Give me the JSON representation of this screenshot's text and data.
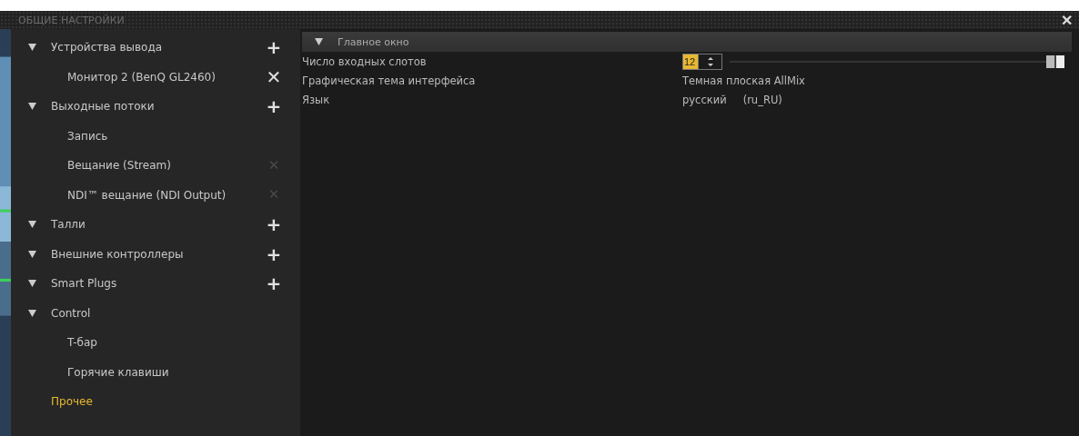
{
  "window": {
    "title": "ОБЩИЕ НАСТРОЙКИ",
    "close": "✕"
  },
  "sidebar": {
    "items": [
      {
        "label": "Устройства вывода",
        "expanded": true,
        "selected": false,
        "button": "+",
        "children": [
          {
            "label": "Монитор 2 (BenQ GL2460)",
            "selected": false,
            "button": "✕",
            "disabled": false
          }
        ]
      },
      {
        "label": "Выходные потоки",
        "expanded": true,
        "selected": false,
        "button": "+",
        "children": [
          {
            "label": "Запись",
            "selected": false
          },
          {
            "label": "Вещание (Stream)",
            "selected": false,
            "button": "✕",
            "disabled": true
          },
          {
            "label": "NDI™ вещание (NDI Output)",
            "selected": false,
            "button": "✕",
            "disabled": true
          }
        ]
      },
      {
        "label": "Талли",
        "expanded": true,
        "selected": false,
        "button": "+"
      },
      {
        "label": "Внешние контроллеры",
        "expanded": true,
        "selected": false,
        "button": "+"
      },
      {
        "label": "Smart Plugs",
        "expanded": true,
        "selected": false,
        "button": "+"
      },
      {
        "label": "Control",
        "expanded": true,
        "selected": false,
        "children": [
          {
            "label": "T-бар",
            "selected": false
          },
          {
            "label": "Горячие клавиши",
            "selected": false
          }
        ]
      },
      {
        "label": "Прочее",
        "selected": true
      }
    ]
  },
  "section": {
    "title": "Главное окно",
    "expanded": true,
    "rows": [
      {
        "kind": "spin",
        "label": "Число входных слотов",
        "value": "12",
        "level": 1.0
      },
      {
        "kind": "text",
        "label": "Графическая тема интерфейса",
        "value": "Темная плоская AllMix"
      },
      {
        "kind": "lang",
        "label": "Язык",
        "value": "русский",
        "code": "(ru_RU)"
      }
    ]
  }
}
